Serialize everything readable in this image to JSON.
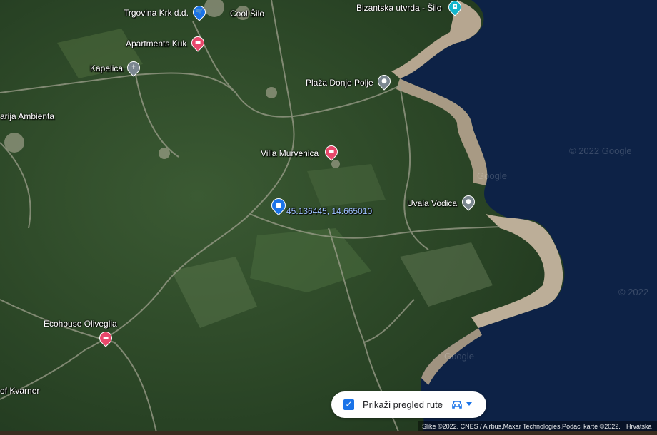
{
  "map": {
    "type": "satellite",
    "place_labels": [
      {
        "id": "trgovina",
        "text": "Trgovina Krk d.d."
      },
      {
        "id": "cool-silo",
        "text": "Cool Šilo"
      },
      {
        "id": "bizantska",
        "text": "Bizantska utvrda - Šilo"
      },
      {
        "id": "apartments-kuk",
        "text": "Apartments Kuk"
      },
      {
        "id": "kapelica",
        "text": "Kapelica"
      },
      {
        "id": "plaza-donje-polje",
        "text": "Plaža Donje Polje"
      },
      {
        "id": "rija-ambienta",
        "text": "arija Ambienta"
      },
      {
        "id": "villa-murvenica",
        "text": "Villa Murvenica"
      },
      {
        "id": "uvala-vodica",
        "text": "Uvala Vodica"
      },
      {
        "id": "ecohouse",
        "text": "Ecohouse Oliveglia"
      },
      {
        "id": "of-kvarner",
        "text": "of Kvarner"
      }
    ],
    "dropped_pin": {
      "coords": "45.136445, 14.665010"
    },
    "watermarks": [
      "© 2022 Google",
      "Google",
      "© 2022",
      "Google"
    ],
    "colors": {
      "sea": "#0d2246",
      "land": "#2f4a2a",
      "accent_red": "#e8486b",
      "accent_blue": "#1a73e8"
    }
  },
  "route_toggle": {
    "label": "Prikaži pregled rute",
    "checked": true,
    "mode_icon": "car-icon"
  },
  "attribution": {
    "imagery": "Slike ©2022. CNES / Airbus,Maxar Technologies,Podaci karte ©2022.",
    "region": "Hrvatska"
  }
}
